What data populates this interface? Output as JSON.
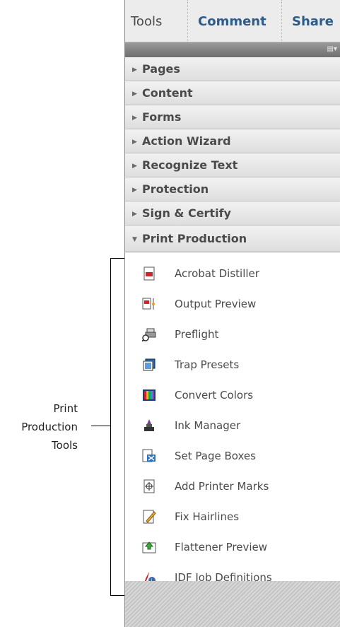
{
  "tabs": [
    "Tools",
    "Comment",
    "Share"
  ],
  "options_icon": "panel-options-icon",
  "sections": [
    "Pages",
    "Content",
    "Forms",
    "Action Wizard",
    "Recognize Text",
    "Protection",
    "Sign & Certify"
  ],
  "expanded_section": "Print Production",
  "tools": [
    {
      "label": "Acrobat Distiller",
      "icon": "acrobat-distiller-icon"
    },
    {
      "label": "Output Preview",
      "icon": "output-preview-icon"
    },
    {
      "label": "Preflight",
      "icon": "preflight-icon"
    },
    {
      "label": "Trap Presets",
      "icon": "trap-presets-icon"
    },
    {
      "label": "Convert Colors",
      "icon": "convert-colors-icon"
    },
    {
      "label": "Ink Manager",
      "icon": "ink-manager-icon"
    },
    {
      "label": "Set Page Boxes",
      "icon": "set-page-boxes-icon"
    },
    {
      "label": "Add Printer Marks",
      "icon": "add-printer-marks-icon"
    },
    {
      "label": "Fix Hairlines",
      "icon": "fix-hairlines-icon"
    },
    {
      "label": "Flattener Preview",
      "icon": "flattener-preview-icon"
    },
    {
      "label": "JDF Job Definitions",
      "icon": "jdf-job-definitions-icon"
    }
  ],
  "callout": [
    "Print",
    "Production",
    "Tools"
  ],
  "colors": {
    "tab_active": "#2d5b8c",
    "text": "#4a4a4a"
  }
}
